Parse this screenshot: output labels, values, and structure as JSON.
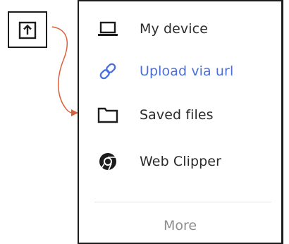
{
  "trigger": {
    "icon": "upload-arrow-icon"
  },
  "menu": {
    "items": [
      {
        "label": "My device",
        "icon": "laptop-icon"
      },
      {
        "label": "Upload via url",
        "icon": "link-icon",
        "active": true
      },
      {
        "label": "Saved files",
        "icon": "folder-icon"
      },
      {
        "label": "Web Clipper",
        "icon": "chrome-icon"
      }
    ],
    "more_label": "More"
  },
  "colors": {
    "accent": "#4a6fd9",
    "text": "#2b2b2b",
    "muted": "#8e8e8e",
    "connector": "#d9613a"
  }
}
